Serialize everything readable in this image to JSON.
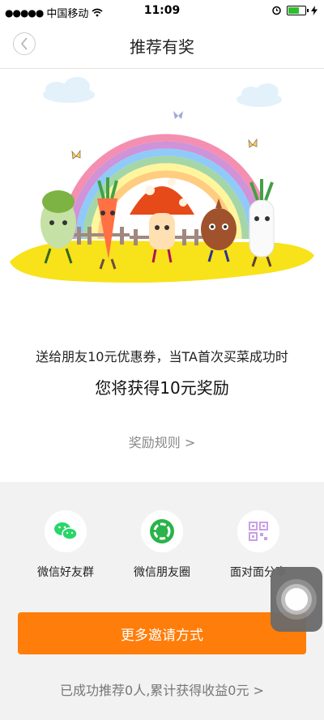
{
  "status_bar": {
    "carrier": "中国移动",
    "time": "11:09"
  },
  "nav": {
    "title": "推荐有奖"
  },
  "hero": {
    "line1": "送给朋友10元优惠券，当TA首次买菜成功时",
    "line2": "您将获得10元奖励",
    "rules": "奖励规则 >"
  },
  "share": {
    "items": [
      {
        "label": "微信好友群",
        "icon": "wechat-icon",
        "color": "#2ad66a"
      },
      {
        "label": "微信朋友圈",
        "icon": "moments-icon",
        "color": "#2bb34a"
      },
      {
        "label": "面对面分享",
        "icon": "qrcode-icon",
        "color": "#c9a0e6"
      }
    ],
    "invite_button": "更多邀请方式",
    "summary": "已成功推荐0人,累计获得收益0元 >"
  },
  "colors": {
    "accent": "#ff7d0a",
    "background": "#f2f2f2"
  }
}
